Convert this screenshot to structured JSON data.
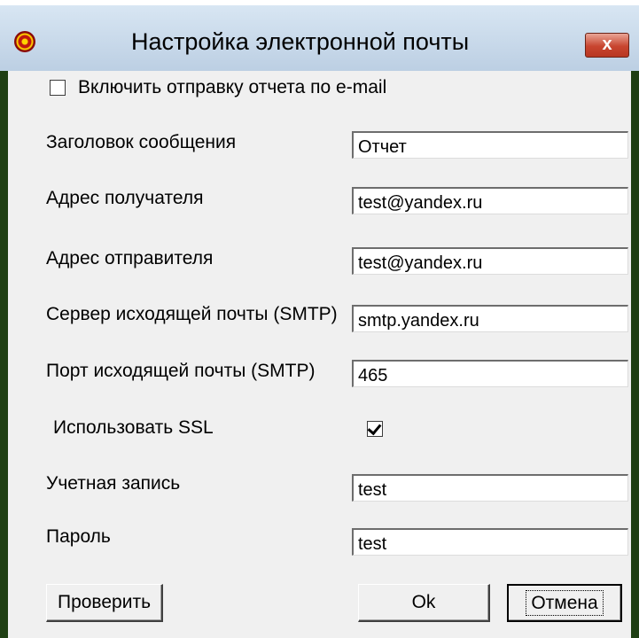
{
  "window": {
    "title": "Настройка электронной почты",
    "close_label": "x"
  },
  "form": {
    "enable_email_label": "Включить отправку отчета по e-mail",
    "enable_email_checked": false,
    "fields": [
      {
        "label": "Заголовок сообщения",
        "value": "Отчет"
      },
      {
        "label": "Адрес получателя",
        "value": "test@yandex.ru"
      },
      {
        "label": "Адрес отправителя",
        "value": "test@yandex.ru"
      },
      {
        "label": "Сервер исходящей почты (SMTP)",
        "value": "smtp.yandex.ru"
      },
      {
        "label": "Порт исходящей почты (SMTP)",
        "value": "465"
      },
      {
        "label": "Учетная запись",
        "value": "test"
      },
      {
        "label": "Пароль",
        "value": "test"
      }
    ],
    "ssl_label": "Использовать SSL",
    "ssl_checked": true
  },
  "buttons": {
    "check": "Проверить",
    "ok": "Ok",
    "cancel": "Отмена"
  }
}
